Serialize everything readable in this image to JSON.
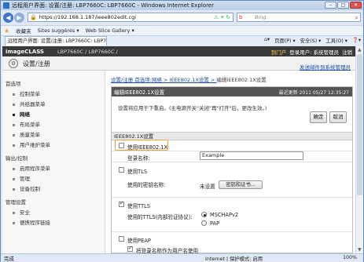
{
  "window": {
    "title": "远程用户界面: 设置/注册: LBP7660C: LBP7660C - Windows Internet Explorer"
  },
  "address": {
    "url": "https://192.168.1.187/ieee802edit.cgi",
    "search_placeholder": "Bing"
  },
  "favorites": {
    "label": "收藏夹",
    "items": [
      "Sites suggérés ▾",
      "Web Slice Gallery ▾"
    ]
  },
  "tab": {
    "label": "远程用户界面: 设置/注册: LBP7660C: LBP7660C"
  },
  "tools": [
    "页面(P) ▾",
    "安全(S) ▾",
    "工具(O) ▾",
    "❓▾"
  ],
  "header": {
    "brand": "imageCLASS",
    "model": "LBP7660C / LBP7660C /",
    "portal": "到门户",
    "user_label": "登录用户: 系统管理员",
    "logout": "注销"
  },
  "subheader": {
    "title": "设置/注册",
    "link": "发送邮件到系统管理员"
  },
  "sidebar": {
    "sections": [
      {
        "title": "首选项",
        "items": [
          "控制菜单",
          "共纸器菜单",
          "网络",
          "布局菜单",
          "质量菜单",
          "用户维护菜单"
        ]
      },
      {
        "title": "输出/控制",
        "items": [
          "启用程序菜单",
          "管理",
          "设备控制"
        ]
      },
      {
        "title": "管理设置",
        "items": [
          "安全",
          "便携程序链接"
        ]
      }
    ],
    "selected": "网络"
  },
  "breadcrumb": {
    "prefix": "设置/注册 首选项:网络 > IEEE802.1X设置 > ",
    "current": "编辑IEEE802.1X设置"
  },
  "panel": {
    "title": "编辑IEEE802.1X设置",
    "updated": "最近更新 2011 05/27 12:35:27",
    "note": "设置将应用于下重启。(主电源开关\"关闭\"再\"打开\"后，更改生效。)",
    "ok": "确定",
    "cancel": "取消",
    "section": "IEEE802.1X设置",
    "use_ieee": "使用IEEE802.1X",
    "login_name_label": "登录名称:",
    "login_name_value": "Example",
    "use_tls": "使用TLS",
    "key_label": "使用的密钥名称:",
    "key_value": "未设置",
    "key_button": "密钥和证书...",
    "use_ttls": "使用TTLS",
    "ttls_label": "使用的TTLS(内部验证协议):",
    "mschap": "MSCHAPv2",
    "pap": "PAP",
    "use_peap": "使用PEAP",
    "user_as_login": "将登录名称作为用户名使用"
  },
  "status": {
    "left": "完成",
    "zone": "Internet | 保护模式: 启用",
    "zoom": "100%"
  }
}
